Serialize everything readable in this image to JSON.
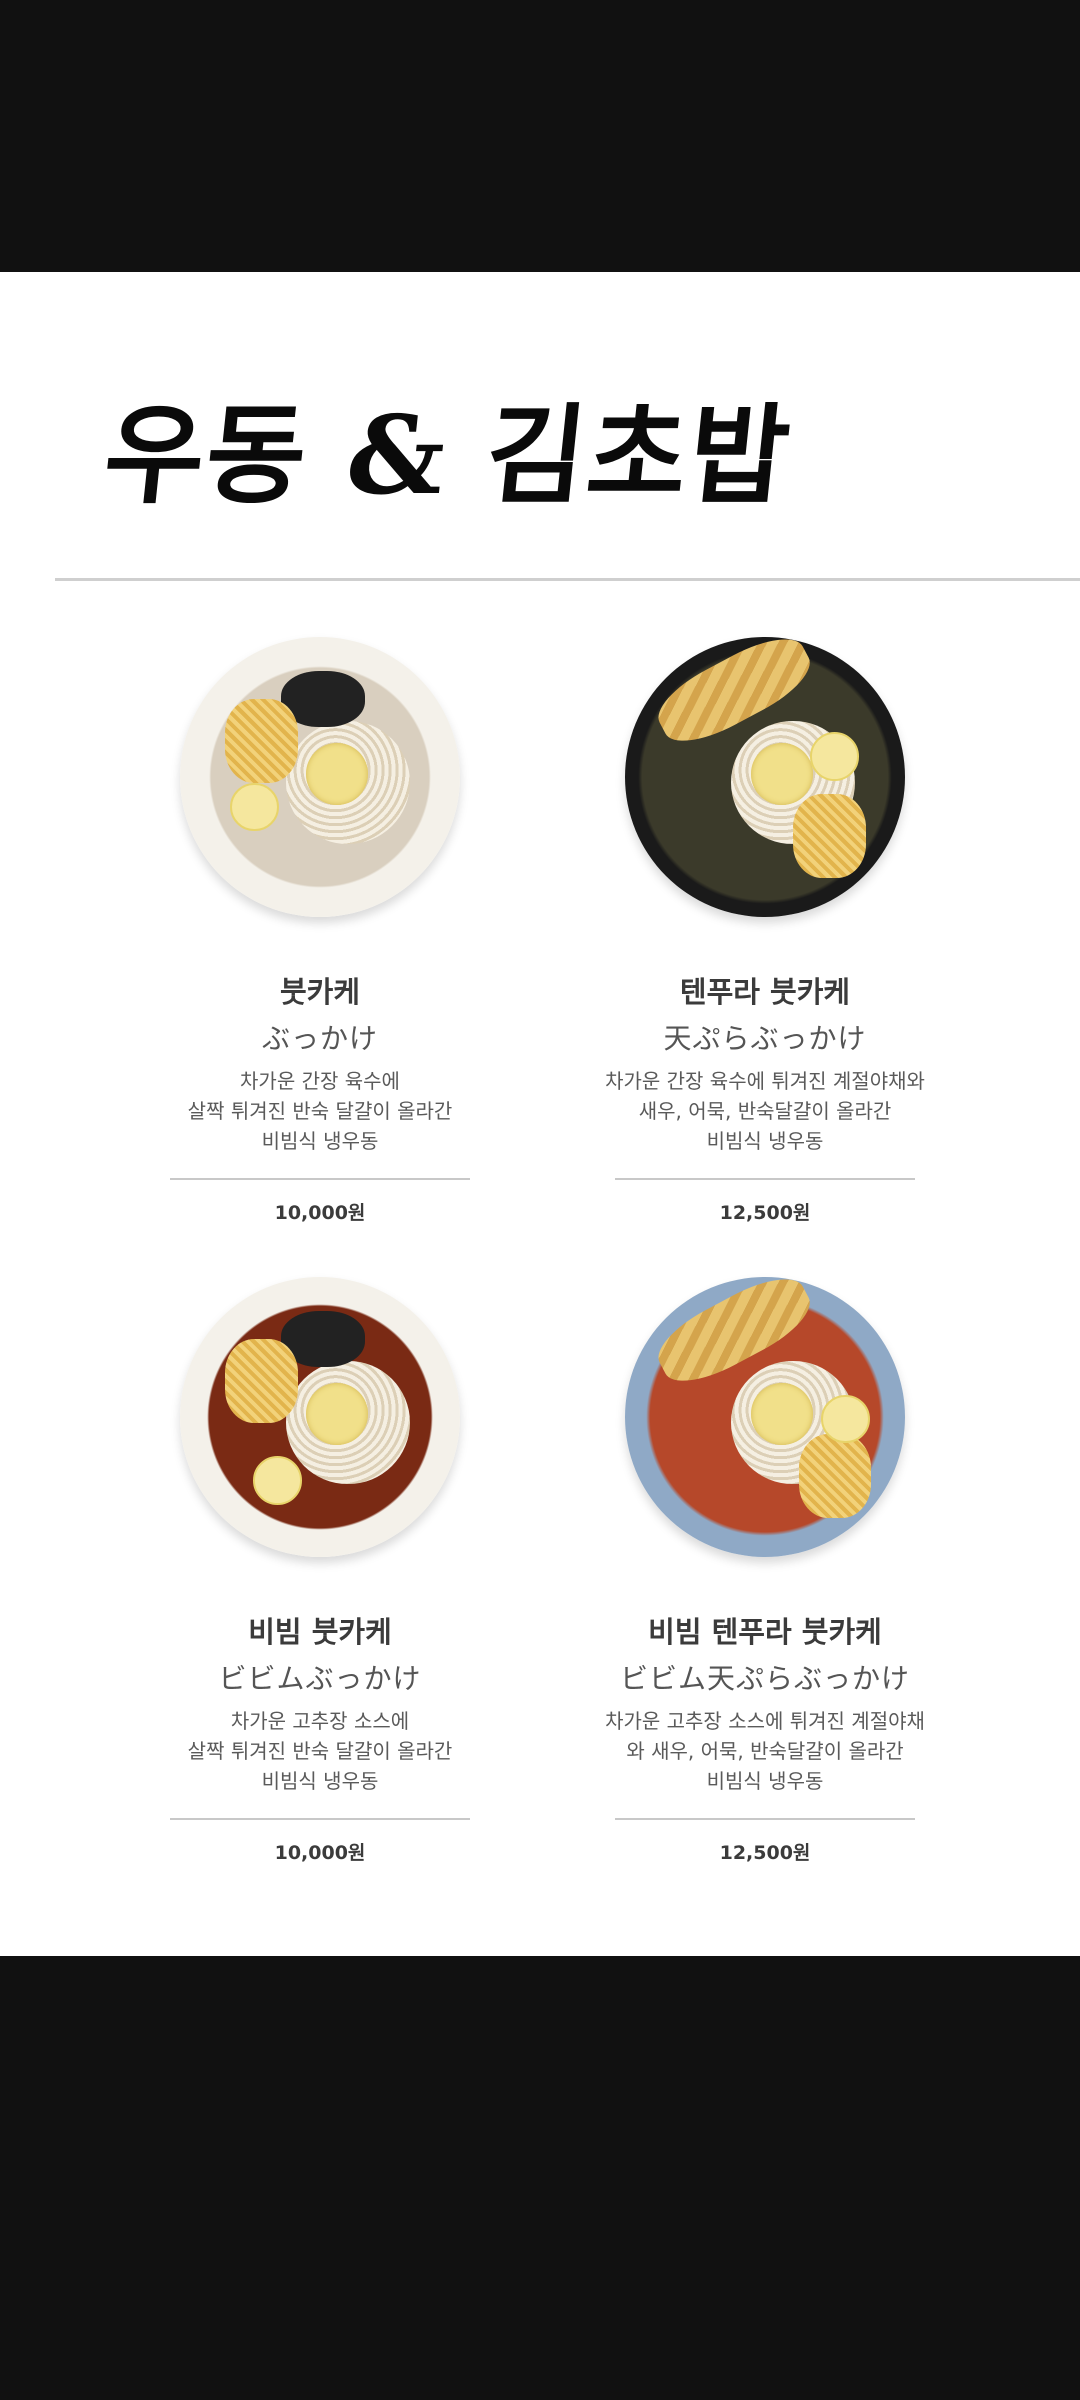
{
  "title": "우동 & 김초밥",
  "items": [
    {
      "name": "붓카케",
      "name_jp": "ぶっかけ",
      "description": [
        "차가운 간장 육수에",
        "살짝 튀겨진 반숙 달걀이 올라간",
        "비빔식 냉우동"
      ],
      "price": "10,000원",
      "bowl_style": "white",
      "toppings": [
        "noodles",
        "egg",
        "flakes",
        "seaweed",
        "lemon"
      ]
    },
    {
      "name": "텐푸라 붓카케",
      "name_jp": "天ぷらぶっかけ",
      "description": [
        "차가운 간장 육수에 튀겨진 계절야채와",
        "새우, 어묵, 반숙달걀이 올라간",
        "비빔식 냉우동"
      ],
      "price": "12,500원",
      "bowl_style": "black",
      "toppings": [
        "noodles",
        "egg",
        "tempura",
        "flakes",
        "lemon"
      ]
    },
    {
      "name": "비빔 붓카케",
      "name_jp": "ビビムぶっかけ",
      "description": [
        "차가운 고추장 소스에",
        "살짝 튀겨진 반숙 달걀이 올라간",
        "비빔식 냉우동"
      ],
      "price": "10,000원",
      "bowl_style": "white",
      "toppings": [
        "noodles",
        "egg",
        "flakes",
        "seaweed",
        "lemon"
      ]
    },
    {
      "name": "비빔 텐푸라 붓카케",
      "name_jp": "ビビム天ぷらぶっかけ",
      "description": [
        "차가운 고추장 소스에 튀겨진 계절야채",
        "와 새우, 어묵, 반숙달걀이 올라간",
        "비빔식 냉우동"
      ],
      "price": "12,500원",
      "bowl_style": "blue",
      "toppings": [
        "noodles",
        "egg",
        "tempura",
        "flakes",
        "lemon"
      ]
    }
  ]
}
